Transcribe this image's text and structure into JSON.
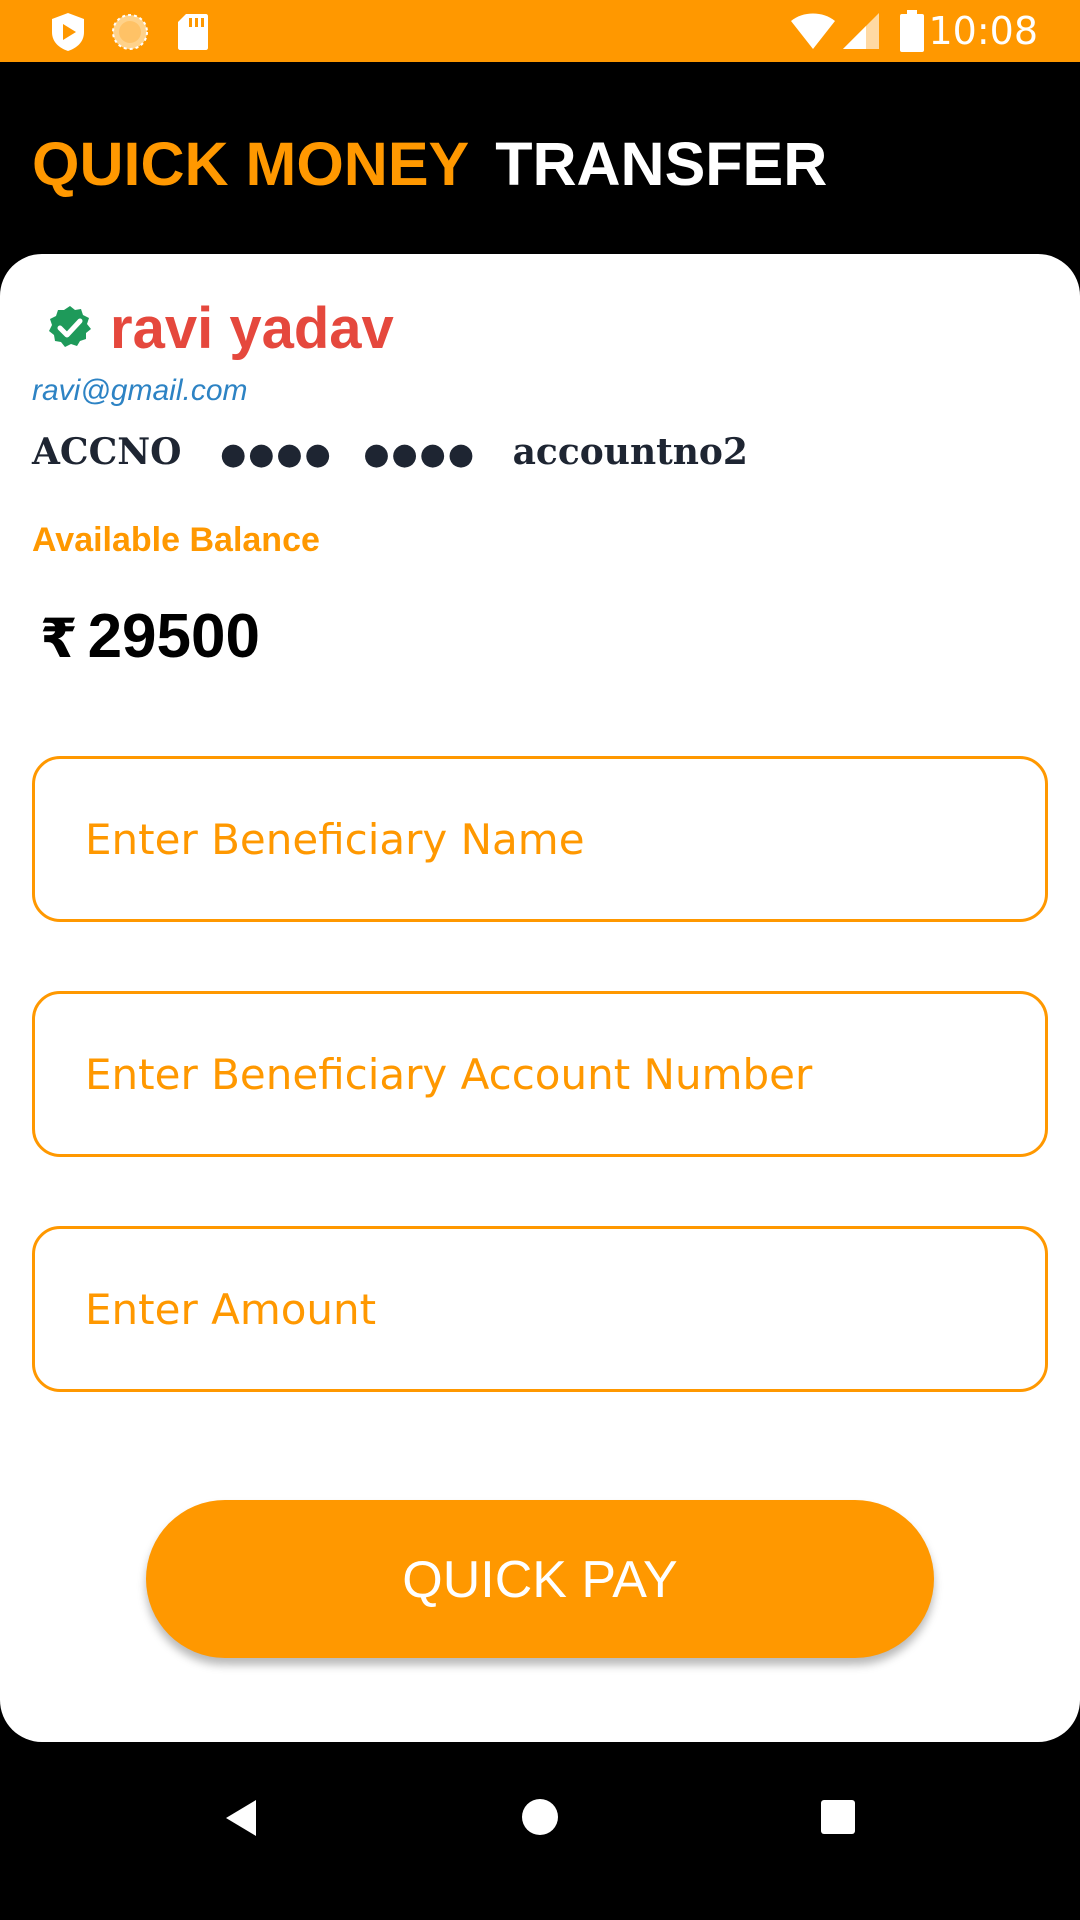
{
  "status_bar": {
    "time": "10:08",
    "left_icons": [
      "play-protect-icon",
      "sun-icon",
      "sd-card-icon"
    ],
    "right_icons": [
      "wifi-icon",
      "signal-icon",
      "battery-icon"
    ],
    "color": "#FF9800"
  },
  "header": {
    "title_part1": "QUICK MONEY",
    "title_part2": "TRANSFER"
  },
  "account": {
    "name": "ravi yadav",
    "verified_icon": "verified-check-icon",
    "email": "ravi@gmail.com",
    "acc_label": "ACCNO",
    "mask_group1": "●●●●",
    "mask_group2": "●●●●",
    "acc_last": "accountno2"
  },
  "balance": {
    "label": "Available Balance",
    "currency": "₹",
    "amount": "29500"
  },
  "form": {
    "beneficiary_name_placeholder": "Enter Beneficiary Name",
    "beneficiary_name_value": "",
    "account_number_placeholder": "Enter Beneficiary Account Number",
    "account_number_value": "",
    "amount_placeholder": "Enter Amount",
    "amount_value": ""
  },
  "pay_button": {
    "label": "QUICK PAY"
  },
  "nav_bar": {
    "icons": [
      "back-icon",
      "home-icon",
      "recents-icon"
    ]
  },
  "colors": {
    "accent": "#FF9800",
    "name": "#E5483D",
    "email": "#2D83C4",
    "verified": "#1E9A5A",
    "background": "#000000",
    "card": "#FFFFFF"
  }
}
